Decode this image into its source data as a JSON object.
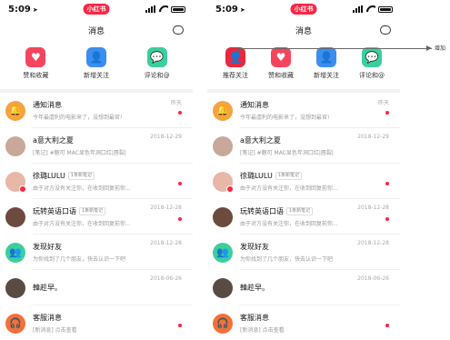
{
  "status": {
    "time": "5:09",
    "app_badge": "小红书"
  },
  "colors": {
    "brand_red": "#ff2442",
    "blue": "#3b8ef0",
    "green": "#3ccf9c",
    "orange": "#f6a23d"
  },
  "nav": {
    "title": "消息"
  },
  "left": {
    "quick_actions": [
      {
        "label": "赞和收藏",
        "icon": "heart-icon",
        "color": "#f5455e"
      },
      {
        "label": "新增关注",
        "icon": "person-icon",
        "color": "#3b8ef0"
      },
      {
        "label": "评论和@",
        "icon": "comment-icon",
        "color": "#3ccf9c"
      }
    ]
  },
  "right": {
    "quick_actions": [
      {
        "label": "推荐关注",
        "icon": "recommend-user-icon",
        "color": "#e8283f"
      },
      {
        "label": "赞和收藏",
        "icon": "heart-icon",
        "color": "#f5455e"
      },
      {
        "label": "新增关注",
        "icon": "person-icon",
        "color": "#3b8ef0"
      },
      {
        "label": "评论和@",
        "icon": "comment-icon",
        "color": "#3ccf9c"
      }
    ]
  },
  "messages": [
    {
      "title": "通知消息",
      "sub": "今年最虐利的电影来了，没想到最官!",
      "time": "昨天",
      "unread": true,
      "tag": ""
    },
    {
      "title": "a意大利之夏",
      "sub": "[笔记] #魅可 MAC显色年洞口红|唇裂|",
      "time": "2018-12-29",
      "unread": false,
      "tag": ""
    },
    {
      "title": "徐璐LULU",
      "sub": "由于对方没有关注你，在收到回复前你...",
      "time": "",
      "unread": true,
      "tag": "1条新笔记"
    },
    {
      "title": "玩转英语口语",
      "sub": "由于对方没有关注你，在收到回复前你...",
      "time": "2018-12-28",
      "unread": true,
      "tag": "1条新笔记"
    },
    {
      "title": "发现好友",
      "sub": "为你找到了几个朋友，快去认识一下吧",
      "time": "2018-12-28",
      "unread": false,
      "tag": ""
    },
    {
      "title": "韓趁早。",
      "sub": "",
      "time": "2018-06-26",
      "unread": false,
      "tag": ""
    },
    {
      "title": "客服消息",
      "sub": "[新消息] 点击查看",
      "time": "",
      "unread": true,
      "tag": ""
    }
  ],
  "annotation": {
    "label": "增加"
  }
}
